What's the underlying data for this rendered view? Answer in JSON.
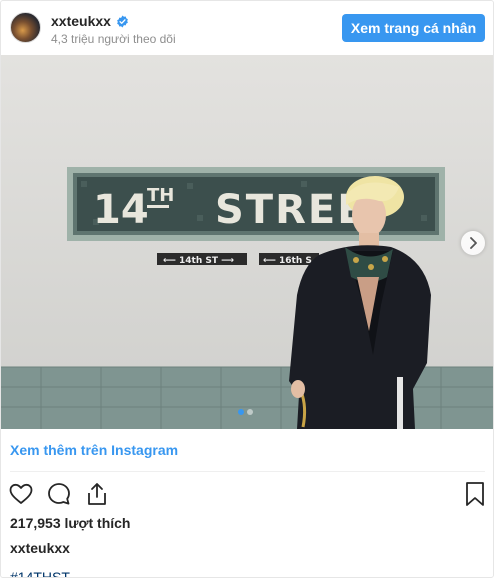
{
  "header": {
    "username": "xxteukxx",
    "followers": "4,3 triệu người theo dõi",
    "view_profile_label": "Xem trang cá nhân",
    "verified_icon": "verified-badge-icon"
  },
  "photo": {
    "sign_text": "14TH STREET",
    "sub_signs": [
      "⟵ 14th ST ⟶",
      "⟵ 16th S"
    ],
    "carousel_count": 2,
    "carousel_active": 1
  },
  "footer": {
    "see_more_label": "Xem thêm trên Instagram",
    "likes": "217,953 lượt thích",
    "caption_user": "xxteukxx",
    "hashtag": "#14THST"
  },
  "colors": {
    "accent": "#3897f0",
    "text": "#262626",
    "muted": "#8e8e8e"
  }
}
